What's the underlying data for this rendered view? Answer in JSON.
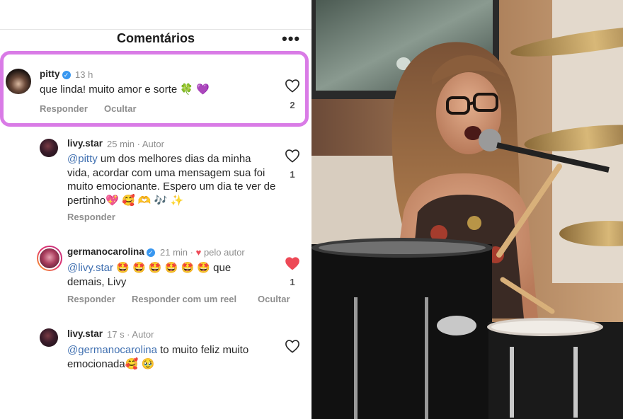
{
  "header": {
    "title": "Comentários",
    "more_label": "•••"
  },
  "comments": [
    {
      "username": "pitty",
      "verified": true,
      "time": "13 h",
      "text": "que linda! muito amor e sorte 🍀 💜",
      "actions": [
        "Responder",
        "Ocultar"
      ],
      "likes": "2",
      "liked": false
    },
    {
      "username": "livy.star",
      "time": "25 min · Autor",
      "mention": "@pitty",
      "text": " um dos melhores dias da minha vida, acordar com uma mensagem sua foi muito emocionante. Espero um dia te ver de pertinho💖 🥰 🫶 🎶 ✨",
      "actions": [
        "Responder"
      ],
      "likes": "1",
      "liked": false
    },
    {
      "username": "germanocarolina",
      "verified": true,
      "time": "21 min ·",
      "liked_by_author": "pelo autor",
      "mention": "@livy.star",
      "text": " 🤩 🤩 🤩 🤩 🤩 🤩  que demais, Livy",
      "actions": [
        "Responder",
        "Responder com um reel",
        "Ocultar"
      ],
      "likes": "1",
      "liked": true
    },
    {
      "username": "livy.star",
      "time": "17 s · Autor",
      "mention": "@germanocarolina",
      "text": " to muito feliz muito emocionada🥰 🥹",
      "actions": [],
      "likes": "",
      "liked": false
    }
  ],
  "colors": {
    "highlight": "#d97be6",
    "mention": "#3f6fb0",
    "like_red": "#ed4956",
    "verified": "#3897f0"
  },
  "icons": {
    "heart": "heart-icon",
    "more": "more-options-icon",
    "verified": "verified-badge-icon"
  }
}
